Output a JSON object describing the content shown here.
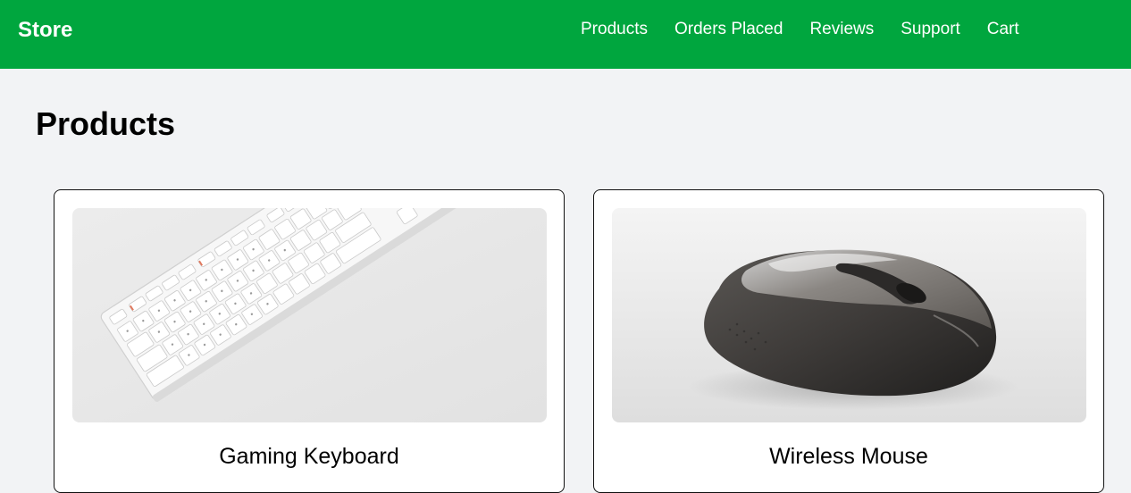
{
  "navbar": {
    "brand": "Store",
    "links": [
      "Products",
      "Orders Placed",
      "Reviews",
      "Support",
      "Cart"
    ]
  },
  "page": {
    "title": "Products"
  },
  "products": [
    {
      "name": "Gaming Keyboard",
      "image": "keyboard-photo"
    },
    {
      "name": "Wireless Mouse",
      "image": "mouse-photo"
    }
  ],
  "colors": {
    "nav_background": "#00a63e",
    "page_background": "#f2f3f5",
    "card_background": "#ffffff"
  }
}
